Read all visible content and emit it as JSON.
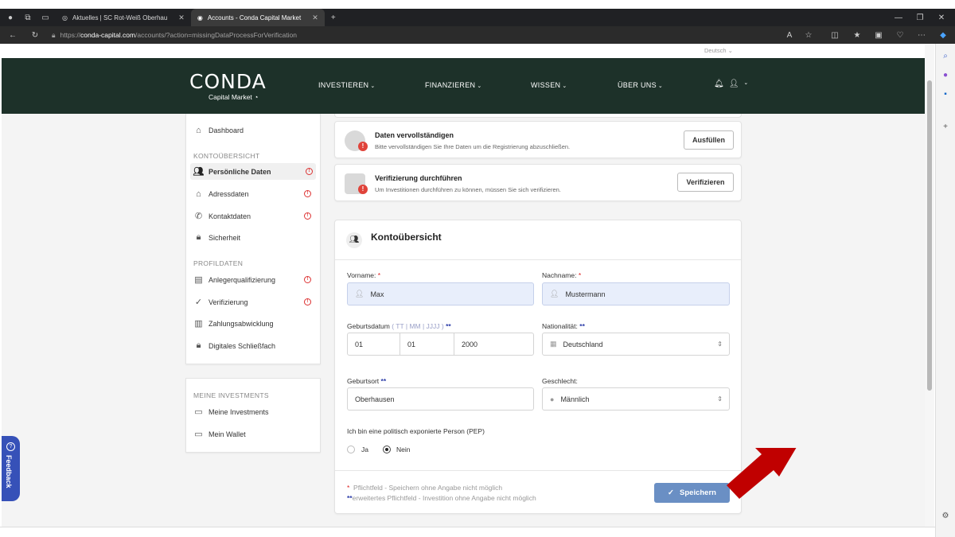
{
  "browser": {
    "tabs": [
      {
        "label": "Aktuelles | SC Rot-Weiß Oberhau"
      },
      {
        "label": "Accounts - Conda Capital Market"
      }
    ],
    "url_prefix": "https://",
    "url_host": "conda-capital.com",
    "url_path": "/accounts/?action=missingDataProcessForVerification"
  },
  "site": {
    "language": "Deutsch",
    "logo_main": "CONDA",
    "logo_sub": "Capital Market",
    "nav": [
      "INVESTIEREN",
      "FINANZIEREN",
      "WISSEN",
      "ÜBER UNS"
    ]
  },
  "sidebar": {
    "dashboard": "Dashboard",
    "section1": "KONTOÜBERSICHT",
    "items1": [
      "Persönliche Daten",
      "Adressdaten",
      "Kontaktdaten",
      "Sicherheit"
    ],
    "section2": "PROFILDATEN",
    "items2": [
      "Anlegerqualifizierung",
      "Verifizierung",
      "Zahlungsabwicklung",
      "Digitales Schließfach"
    ],
    "section3": "MEINE INVESTMENTS",
    "items3": [
      "Meine Investments",
      "Mein Wallet"
    ]
  },
  "notices": [
    {
      "title": "Daten vervollständigen",
      "text": "Bitte vervollständigen Sie Ihre Daten um die Registrierung abzuschließen.",
      "button": "Ausfüllen"
    },
    {
      "title": "Verifizierung durchführen",
      "text": "Um Investitionen durchführen zu können, müssen Sie sich verifizieren.",
      "button": "Verifizieren"
    }
  ],
  "form": {
    "title": "Kontoübersicht",
    "vorname_label": "Vorname:",
    "vorname_value": "Max",
    "nachname_label": "Nachname:",
    "nachname_value": "Mustermann",
    "geburtsdatum_label": "Geburtsdatum",
    "geburtsdatum_hint": "( TT | MM | JJJJ )",
    "day": "01",
    "month": "01",
    "year": "2000",
    "nationalitaet_label": "Nationalität:",
    "nationalitaet_value": "Deutschland",
    "geburtsort_label": "Geburtsort",
    "geburtsort_value": "Oberhausen",
    "geschlecht_label": "Geschlecht:",
    "geschlecht_value": "Männlich",
    "pep_label": "Ich bin eine politisch exponierte Person (PEP)",
    "pep_yes": "Ja",
    "pep_no": "Nein",
    "footnote1": "Pflichtfeld - Speichern ohne Angabe nicht möglich",
    "footnote2": "erweitertes Pflichtfeld - Investition ohne Angabe nicht möglich",
    "save": "Speichern"
  },
  "feedback": "Feedback",
  "colors": {
    "header_bg": "#1d3129",
    "save_button": "#6a8fc4",
    "arrow": "#c00000",
    "feedback": "#3651b8"
  }
}
